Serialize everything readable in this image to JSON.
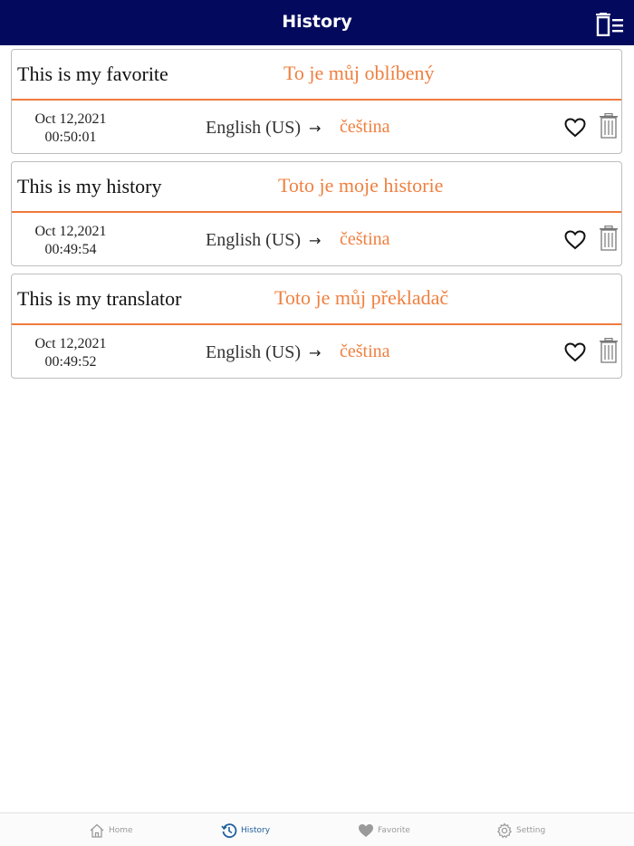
{
  "header": {
    "title": "History",
    "clear_icon": "clear-list-icon"
  },
  "items": [
    {
      "source_text": "This is my favorite",
      "translation": "To je můj oblíbený",
      "date": "Oct 12,2021",
      "time": "00:50:01",
      "source_lang": "English (US)",
      "arrow": "→",
      "target_lang": "čeština"
    },
    {
      "source_text": "This is my history",
      "translation": "Toto je moje historie",
      "date": "Oct 12,2021",
      "time": "00:49:54",
      "source_lang": "English (US)",
      "arrow": "→",
      "target_lang": "čeština"
    },
    {
      "source_text": "This is my translator",
      "translation": "Toto je můj překladač",
      "date": "Oct 12,2021",
      "time": "00:49:52",
      "source_lang": "English (US)",
      "arrow": "→",
      "target_lang": "čeština"
    }
  ],
  "tabs": {
    "home": "Home",
    "history": "History",
    "favorite": "Favorite",
    "setting": "Setting"
  },
  "colors": {
    "navbar": "#030a5e",
    "accent": "#ef8040",
    "active_tab": "#1f5fa0"
  }
}
